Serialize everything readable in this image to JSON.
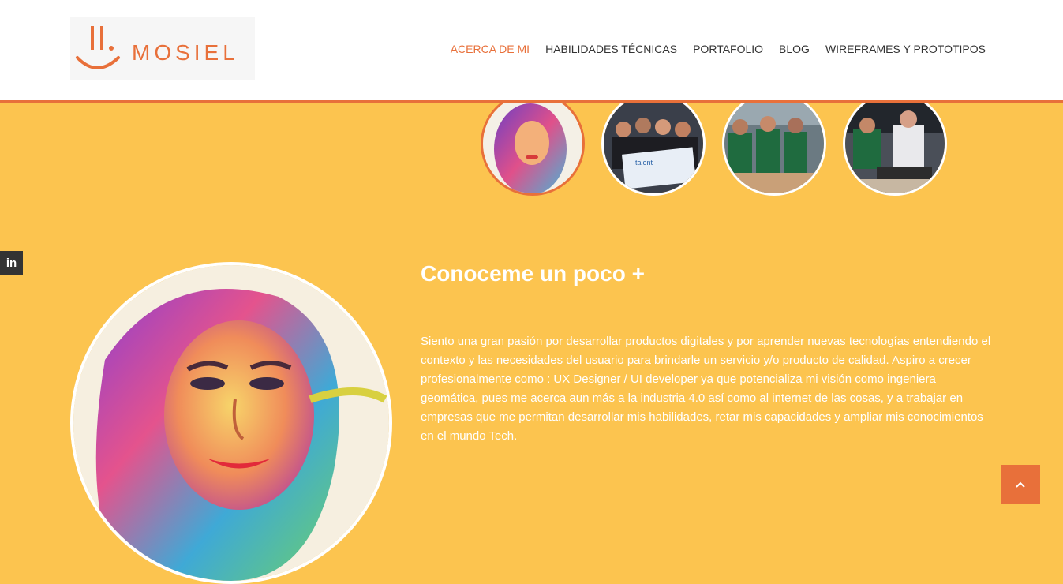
{
  "header": {
    "logo_text": "MOSIEL",
    "nav": [
      {
        "label": "ACERCA DE MI",
        "active": true
      },
      {
        "label": "HABILIDADES TÉCNICAS",
        "active": false
      },
      {
        "label": "PORTAFOLIO",
        "active": false
      },
      {
        "label": "BLOG",
        "active": false
      },
      {
        "label": "WIREFRAMES Y PROTOTIPOS",
        "active": false
      }
    ]
  },
  "colors": {
    "accent": "#E8703A",
    "background": "#FCC44F",
    "nav_text": "#333333"
  },
  "social": {
    "linkedin_label": "in"
  },
  "about": {
    "title": "Conoceme un poco +",
    "text": "Siento una gran pasión por desarrollar productos digitales y por aprender nuevas tecnologías entendiendo el contexto y las necesidades del usuario para brindarle un servicio y/o producto de calidad. Aspiro a crecer profesionalmente como : UX Designer / UI developer ya que potencializa mi visión como ingeniera geomática, pues me acerca aun más a la industria 4.0 así como al internet de las cosas, y a trabajar en empresas que me permitan desarrollar mis habilidades, retar mis capacidades y ampliar mis conocimientos en el mundo Tech."
  },
  "back_to_top_icon": "chevron-up-icon"
}
